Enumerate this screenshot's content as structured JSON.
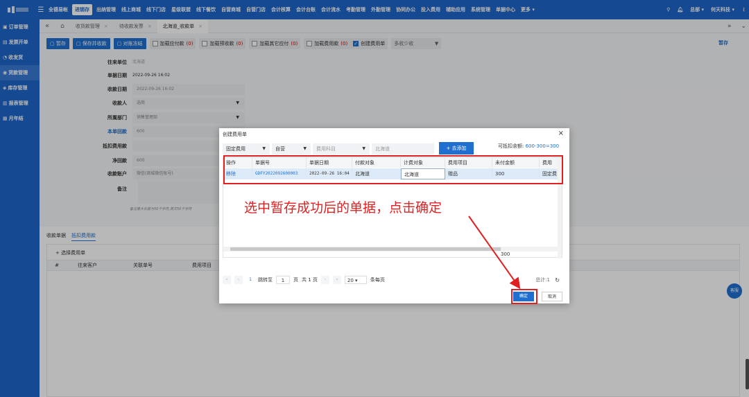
{
  "topnav": {
    "items": [
      "全德易帐",
      "进销存",
      "出纳管理",
      "线上商城",
      "线下门店",
      "星级联盟",
      "线下餐饮",
      "自营商城",
      "自营门店",
      "会计核算",
      "会计台账",
      "会计流水",
      "考勤管理",
      "外勤管理",
      "协同办公",
      "投入费用",
      "辅助应用",
      "系统管理",
      "单据中心",
      "更多 ▾"
    ],
    "active_index": 1,
    "user_menu": "总部 ▾",
    "company_menu": "何天科技 ▾"
  },
  "sidebar": {
    "items": [
      "订单管理",
      "发票开单",
      "收发货",
      "货款管理",
      "库存管理",
      "报表管理",
      "月年结"
    ],
    "active_index": 3
  },
  "tabs": {
    "items": [
      "收货款管理",
      "待收款发票",
      "北海道_收款单"
    ],
    "active_index": 2
  },
  "toolbar": {
    "buttons": [
      "暂存",
      "保存并收款",
      "对账冻结"
    ],
    "checks": [
      {
        "label": "加载应付款",
        "count": "(0)",
        "checked": false
      },
      {
        "label": "加载预收款",
        "count": "(0)",
        "checked": false
      },
      {
        "label": "加载其它应付",
        "count": "(0)",
        "checked": false
      },
      {
        "label": "加载费用款",
        "count": "(0)",
        "checked": false
      }
    ],
    "create_fee_label": "创建费用单",
    "multi_select": "多收少收",
    "save_link": "暂存"
  },
  "form": {
    "fields": [
      {
        "label": "往来单位",
        "value": "北海道",
        "style": "plain"
      },
      {
        "label": "单据日期",
        "value": "2022-09-26 16:02",
        "style": "plain"
      },
      {
        "label": "收款日期",
        "value": "2022-09-26 16:02",
        "style": "box"
      },
      {
        "label": "收款人",
        "value": "选商",
        "style": "select"
      },
      {
        "label": "所属部门",
        "value": "销售管理部",
        "style": "select"
      },
      {
        "label": "本单回款",
        "value": "600",
        "style": "box"
      },
      {
        "label": "抵扣费用款",
        "value": "",
        "style": "box"
      },
      {
        "label": "净回款",
        "value": "600",
        "style": "box"
      },
      {
        "label": "收款账户",
        "value": "微信(商城微信账号)",
        "style": "select"
      },
      {
        "label": "备注",
        "value": "",
        "style": "none"
      }
    ],
    "note_hint": "备注最大长度为50个字符,英文50个字符"
  },
  "bottom": {
    "tabs": [
      "收款单据",
      "抵扣费用款"
    ],
    "active_index": 1,
    "add_label": "+ 选择费用单",
    "columns": [
      "#",
      "往来客户",
      "关联单号",
      "费用项目"
    ]
  },
  "help_badge": "客服",
  "modal": {
    "title": "创建费用单",
    "filters": [
      {
        "value": "固定费用",
        "placeholder": false
      },
      {
        "value": "自营",
        "placeholder": false
      },
      {
        "value": "费用科目",
        "placeholder": true
      },
      {
        "value": "北海道",
        "placeholder": true
      }
    ],
    "add_button": "+ 去添加",
    "balance_label": "可抵扣余额:",
    "balance_value": "600-300=300",
    "columns": [
      "操作",
      "单据号",
      "单据日期",
      "付款对象",
      "计费对象",
      "费用项目",
      "未付金额",
      "费用"
    ],
    "rows": [
      {
        "op": "移除",
        "no": "GDFY2022092600003",
        "date": "2022-09-26 16:04",
        "payer": "北海道",
        "billing": "北海道",
        "item": "赠品",
        "unpaid": "300",
        "type": "固定费"
      }
    ],
    "sum_value": "300",
    "pager": {
      "first": "«",
      "prev": "‹",
      "current": "1",
      "goto_label": "跳转至",
      "goto_value": "1",
      "page_suffix": "页",
      "total_pages": "共 1 页",
      "next": "›",
      "last": "»",
      "page_size": "20",
      "per_page_label": "条每页",
      "total_label": "总计:1",
      "refresh": "↻"
    },
    "ok": "确定",
    "cancel": "取消"
  },
  "annotation": "选中暂存成功后的单据，点击确定",
  "colors": {
    "brand": "#1e66c9",
    "highlight": "#e02020",
    "row_selected": "#ddeaf8"
  }
}
